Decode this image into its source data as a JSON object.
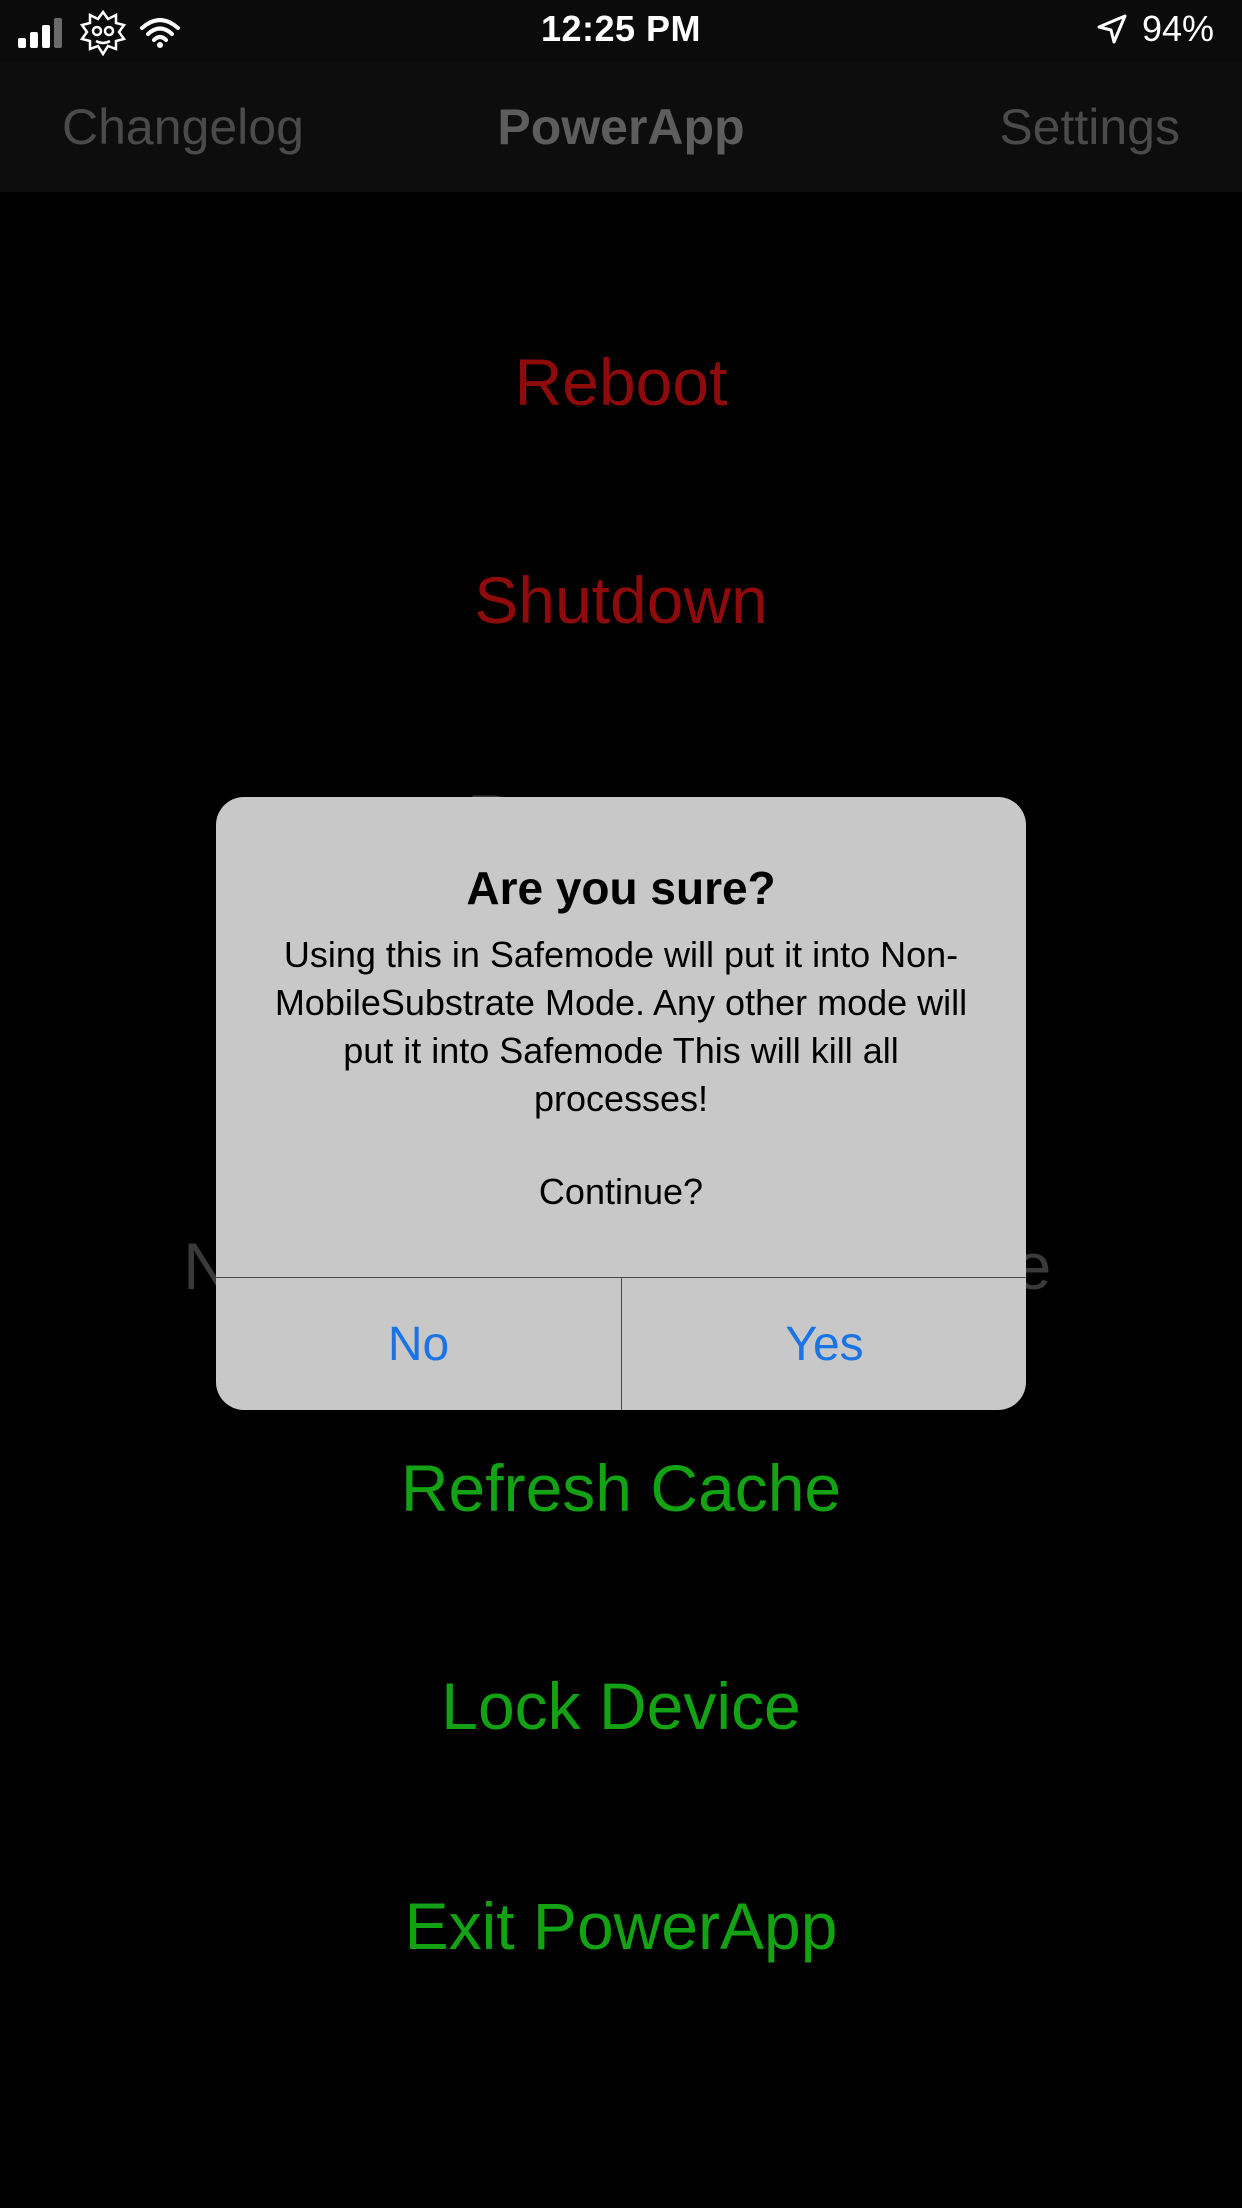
{
  "status_bar": {
    "time": "12:25 PM",
    "battery": "94%",
    "icons": [
      "cellular-signal-icon",
      "rick-face-icon",
      "wifi-icon",
      "location-arrow-icon"
    ]
  },
  "nav": {
    "left": "Changelog",
    "title": "PowerApp",
    "right": "Settings"
  },
  "menu": {
    "reboot": "Reboot",
    "shutdown": "Shutdown",
    "respring_partial": "R",
    "nms_left": "N",
    "nms_right": "e",
    "refresh_cache": "Refresh Cache",
    "lock_device": "Lock Device",
    "exit": "Exit PowerApp"
  },
  "alert": {
    "title": "Are you sure?",
    "message": "Using this in Safemode will put it into Non-MobileSubstrate Mode. Any other mode will put it into Safemode This will kill all processes!",
    "continue": "Continue?",
    "no": "No",
    "yes": "Yes"
  },
  "colors": {
    "danger": "#8f0b0b",
    "success": "#13a213",
    "link": "#1b74e6",
    "alert_bg": "#c8c8c8"
  }
}
